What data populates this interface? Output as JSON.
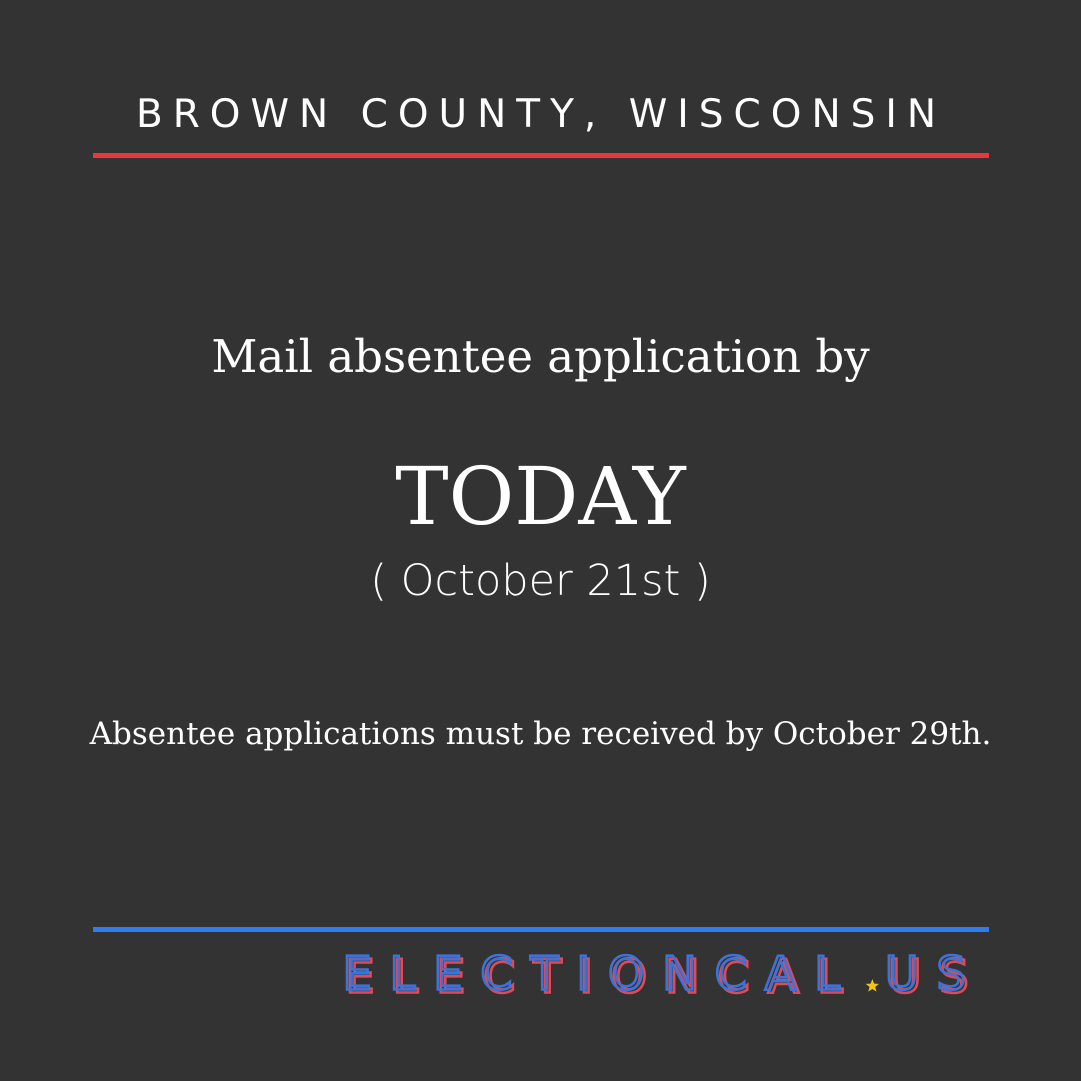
{
  "county": "BROWN COUNTY, WISCONSIN",
  "headline": "Mail absentee application by",
  "deadline": "TODAY",
  "date": "( October 21st )",
  "note": "Absentee applications must be received by October 29th.",
  "brand": {
    "name": "ELECTIONCAL.US",
    "icon": "star-icon"
  },
  "colors": {
    "background": "#333333",
    "text": "#ffffff",
    "top_rule": "#e8383b",
    "bottom_rule": "#2f7bf0",
    "brand_red": "#e14a55",
    "brand_blue": "#3d73d8",
    "star": "#f1c40f"
  }
}
